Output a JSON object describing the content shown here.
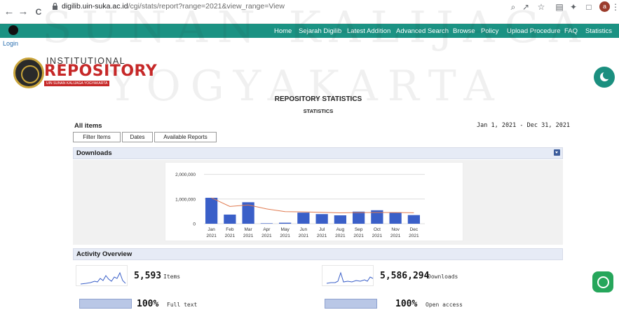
{
  "browser": {
    "back_glyph": "←",
    "forward_glyph": "→",
    "reload_glyph": "C",
    "url_host": "digilib.uin-suka.ac.id",
    "url_path": "/cgi/stats/report?range=2021&view_range=View",
    "icons": [
      "zoom-icon",
      "share-icon",
      "star-icon",
      "reading-list-icon",
      "extensions-icon",
      "window-icon",
      "profile-avatar",
      "menu-icon"
    ],
    "avatar_letter": "a"
  },
  "nav": {
    "items": [
      "Home",
      "Sejarah Digilib",
      "Latest Addition",
      "Advanced Search",
      "Browse",
      "Policy",
      "Upload Procedure",
      "FAQ",
      "Statistics"
    ],
    "login": "Login"
  },
  "watermark": {
    "line1": "SUNAN KALIJAGA",
    "line2": "YOGYAKARTA"
  },
  "logo": {
    "top": "INSTITUTIONAL",
    "main": "REPOSITORY",
    "sub": "UIN SUNAN KALIJAGA YOGYAKARTA"
  },
  "page": {
    "title": "REPOSITORY STATISTICS",
    "subtitle": "STATISTICS",
    "section": "All items",
    "date_range": "Jan 1, 2021 - Dec 31, 2021",
    "buttons": [
      "Filter Items",
      "Dates",
      "Available Reports"
    ]
  },
  "downloads": {
    "heading": "Downloads"
  },
  "chart_data": {
    "type": "bar",
    "categories": [
      "Jan\n2021",
      "Feb\n2021",
      "Mar\n2021",
      "Apr\n2021",
      "May\n2021",
      "Jun\n2021",
      "Jul\n2021",
      "Aug\n2021",
      "Sep\n2021",
      "Oct\n2021",
      "Nov\n2021",
      "Dec\n2021"
    ],
    "series": [
      {
        "type": "bar",
        "values": [
          1050000,
          370000,
          870000,
          18000,
          40000,
          450000,
          390000,
          340000,
          490000,
          545000,
          460000,
          350000
        ]
      },
      {
        "type": "line",
        "values": [
          1050000,
          700000,
          760000,
          600000,
          490000,
          480000,
          460000,
          440000,
          450000,
          455000,
          455000,
          445000
        ]
      }
    ],
    "y_ticks": [
      "0",
      "1,000,000",
      "2,000,000"
    ],
    "ylim": [
      0,
      2300000
    ],
    "grid": true,
    "colors": {
      "bar": "#3a5fc8",
      "line": "#e07a4f"
    }
  },
  "activity": {
    "heading": "Activity Overview",
    "items_value": "5,593",
    "items_label": "Items",
    "downloads_value": "5,586,294",
    "downloads_label": "Downloads",
    "fulltext_value": "100%",
    "fulltext_label": "Full text",
    "fulltext_fraction": 1.0,
    "openaccess_value": "100%",
    "openaccess_label": "Open access",
    "openaccess_fraction": 1.0
  },
  "colors": {
    "menu_bg": "#1b9283",
    "logo_red": "#c62828",
    "panel_bg": "#e6ebf6",
    "accent_blue": "#3a5fc8"
  }
}
